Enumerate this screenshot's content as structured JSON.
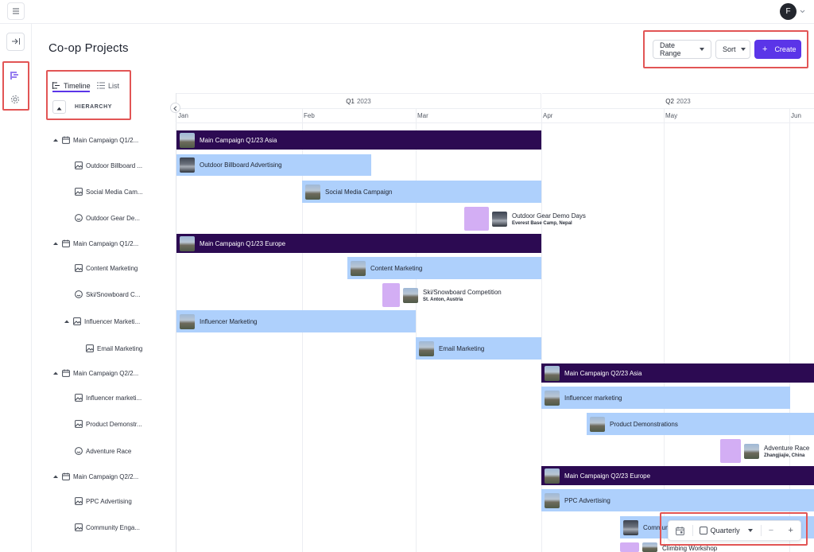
{
  "user": {
    "initial": "F"
  },
  "page": {
    "title": "Co-op Projects"
  },
  "actions": {
    "date_range": "Date Range",
    "sort": "Sort",
    "create": "Create"
  },
  "views": {
    "timeline": "Timeline",
    "list": "List",
    "hierarchy": "HIERARCHY"
  },
  "timeline": {
    "quarters": [
      {
        "label": "Q1",
        "year": "2023"
      },
      {
        "label": "Q2",
        "year": "2023"
      }
    ],
    "months": [
      "Jan",
      "Feb",
      "Mar",
      "Apr",
      "May",
      "Jun"
    ]
  },
  "tree": [
    {
      "label": "Main Campaign Q1/2...",
      "icon": "calendar-icon",
      "expanded": true
    },
    {
      "label": "Outdoor Billboard ...",
      "icon": "image-icon"
    },
    {
      "label": "Social Media Cam...",
      "icon": "image-icon"
    },
    {
      "label": "Outdoor Gear De...",
      "icon": "smiley-icon"
    },
    {
      "label": "Main Campaign Q1/2...",
      "icon": "calendar-icon",
      "expanded": true
    },
    {
      "label": "Content Marketing",
      "icon": "image-icon"
    },
    {
      "label": "Ski/Snowboard C...",
      "icon": "smiley-icon"
    },
    {
      "label": "Influencer Marketi...",
      "icon": "image-icon",
      "expanded": true
    },
    {
      "label": "Email Marketing",
      "icon": "image-icon"
    },
    {
      "label": "Main Campaign Q2/2...",
      "icon": "calendar-icon",
      "expanded": true
    },
    {
      "label": "Influencer marketi...",
      "icon": "image-icon"
    },
    {
      "label": "Product Demonstr...",
      "icon": "image-icon"
    },
    {
      "label": "Adventure Race",
      "icon": "smiley-icon"
    },
    {
      "label": "Main Campaign Q2/2...",
      "icon": "calendar-icon",
      "expanded": true
    },
    {
      "label": "PPC Advertising",
      "icon": "image-icon"
    },
    {
      "label": "Community Enga...",
      "icon": "image-icon"
    }
  ],
  "bars": [
    {
      "label": "Main Campaign Q1/23 Asia",
      "kind": "campaign"
    },
    {
      "label": "Outdoor Billboard Advertising",
      "kind": "activity"
    },
    {
      "label": "Social Media Campaign",
      "kind": "activity"
    },
    {
      "label": "Main Campaign Q1/23 Europe",
      "kind": "campaign"
    },
    {
      "label": "Content Marketing",
      "kind": "activity"
    },
    {
      "label": "Influencer Marketing",
      "kind": "activity"
    },
    {
      "label": "Email Marketing",
      "kind": "activity"
    },
    {
      "label": "Main Campaign Q2/23 Asia",
      "kind": "campaign"
    },
    {
      "label": "Influencer marketing",
      "kind": "activity"
    },
    {
      "label": "Product Demonstrations",
      "kind": "activity"
    },
    {
      "label": "Main Campaign Q2/23 Europe",
      "kind": "campaign"
    },
    {
      "label": "PPC Advertising",
      "kind": "activity"
    },
    {
      "label": "Community",
      "kind": "activity"
    }
  ],
  "events": [
    {
      "title": "Outdoor Gear Demo Days",
      "location": "Everest Base Camp, Nepal"
    },
    {
      "title": "Ski/Snowboard Competition",
      "location": "St. Anton, Austria"
    },
    {
      "title": "Adventure Race",
      "location": "Zhangjiajie, China"
    },
    {
      "title": "Climbing Workshop",
      "location": ""
    }
  ],
  "zoom": {
    "level": "Quarterly",
    "minus": "−",
    "plus": "+"
  },
  "colors": {
    "accent": "#5b35e8",
    "campaign_bar": "#2c0a52",
    "activity_bar": "#aed0fc",
    "event_swatch": "#d3aef4",
    "highlight": "#e25555"
  }
}
